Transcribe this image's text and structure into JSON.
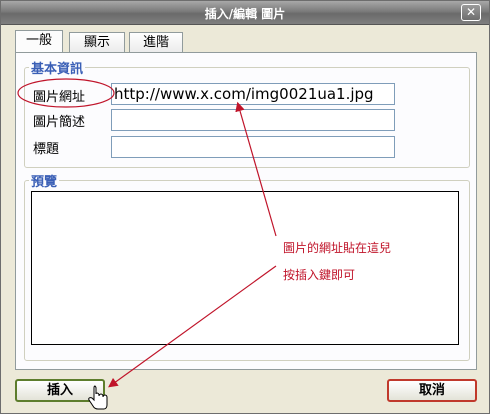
{
  "window": {
    "title": "插入/編輯 圖片",
    "close_icon": "close-icon"
  },
  "tabs": [
    {
      "label": "一般",
      "active": true
    },
    {
      "label": "顯示",
      "active": false
    },
    {
      "label": "進階",
      "active": false
    }
  ],
  "basic_info": {
    "legend": "基本資訊",
    "fields": [
      {
        "label": "圖片網址",
        "value": "http://www.x.com/img0021ua1.jpg"
      },
      {
        "label": "圖片簡述",
        "value": ""
      },
      {
        "label": "標題",
        "value": ""
      }
    ]
  },
  "preview": {
    "legend": "預覽"
  },
  "annotations": {
    "line1": "圖片的網址貼在這兒",
    "line2": "按插入鍵即可",
    "color": "#c0142a"
  },
  "buttons": {
    "insert": "插入",
    "cancel": "取消"
  }
}
